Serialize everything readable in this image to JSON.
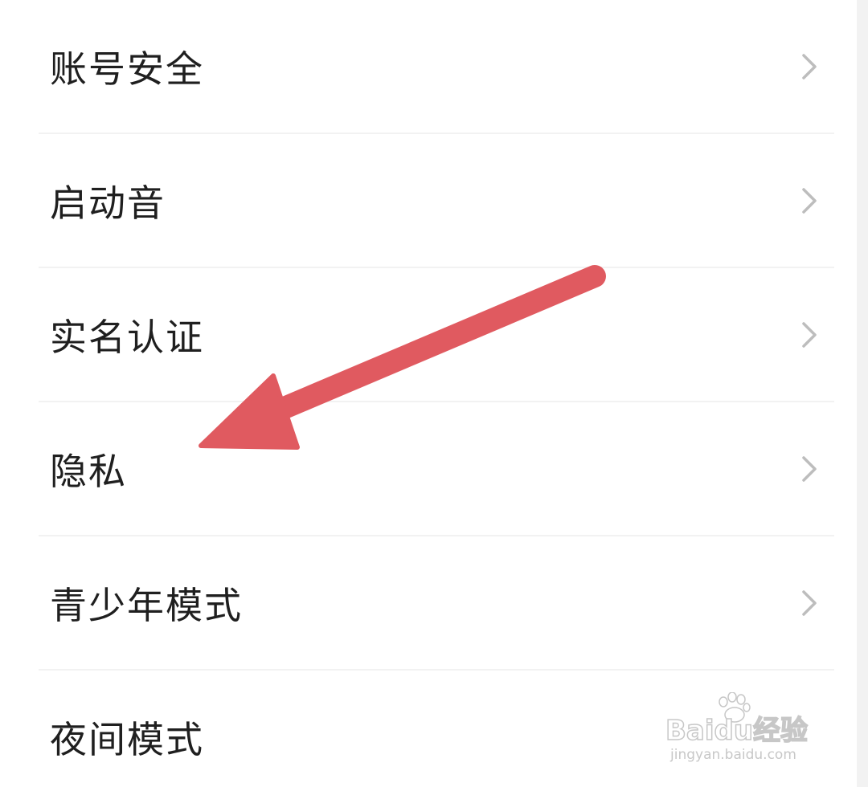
{
  "settings_list": {
    "items": [
      {
        "label": "账号安全"
      },
      {
        "label": "启动音"
      },
      {
        "label": "实名认证"
      },
      {
        "label": "隐私"
      },
      {
        "label": "青少年模式"
      },
      {
        "label": "夜间模式"
      }
    ]
  },
  "annotation": {
    "arrow_color": "#e05a60"
  },
  "watermark": {
    "brand": "Baidu经验",
    "url": "jingyan.baidu.com"
  },
  "colors": {
    "text": "#1f1f1f",
    "chevron": "#bdbdbd",
    "divider": "#f2f2f2"
  }
}
